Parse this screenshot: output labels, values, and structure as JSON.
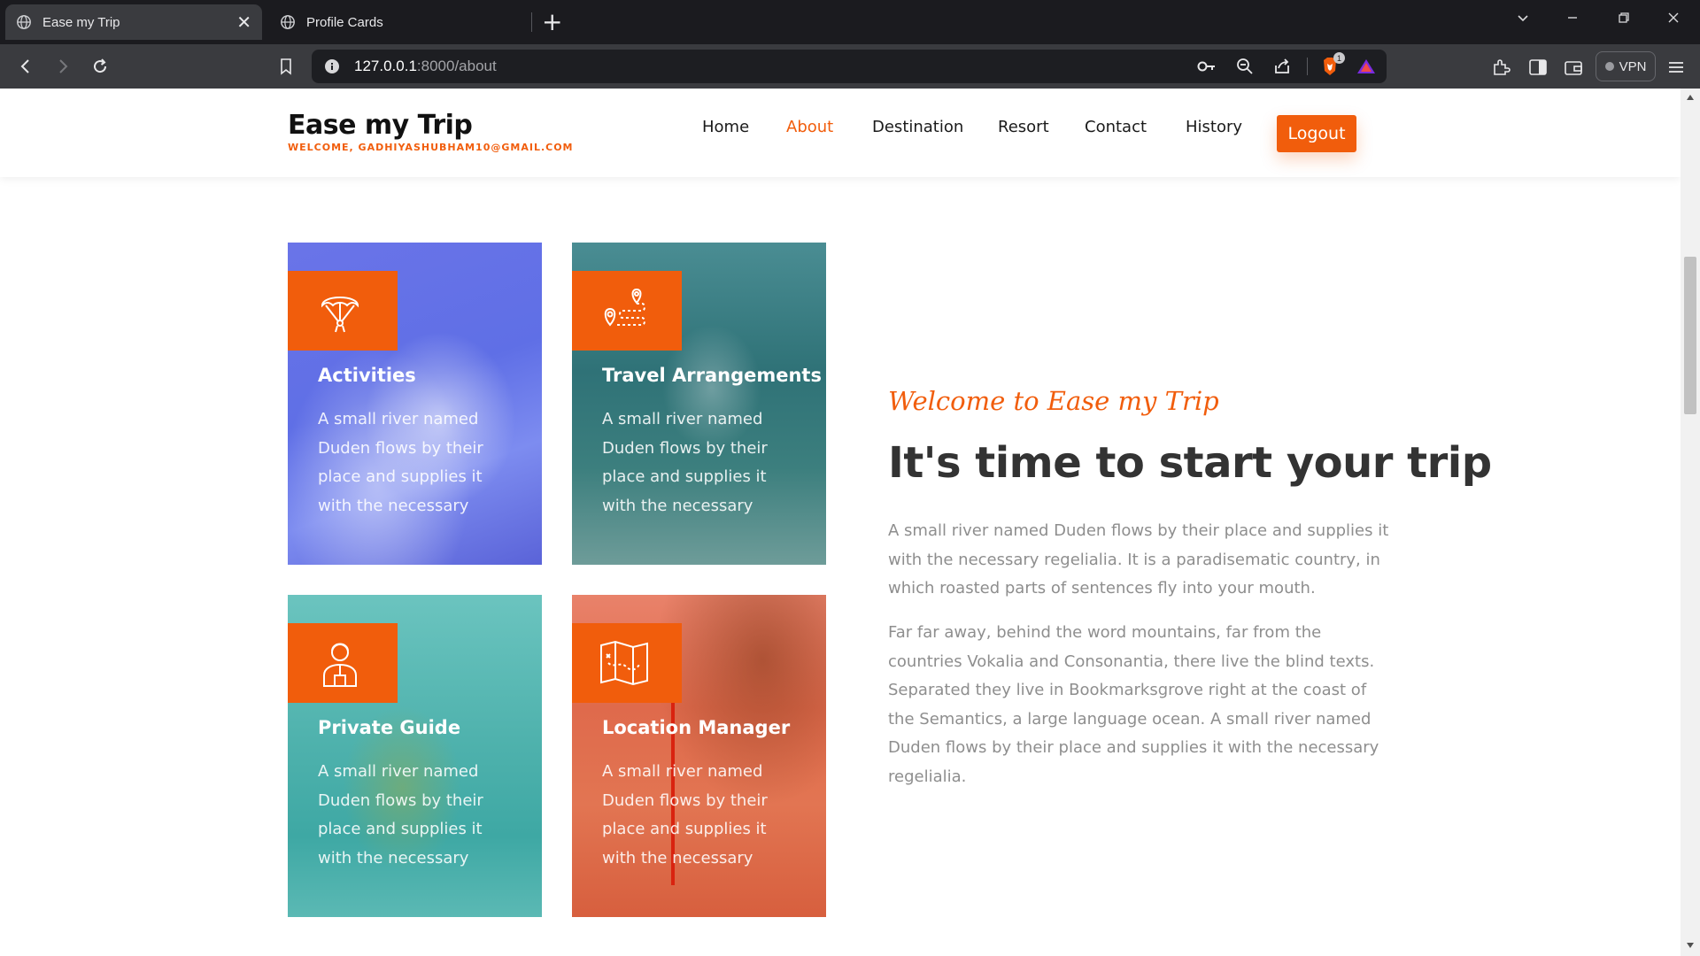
{
  "browser": {
    "tabs": [
      {
        "title": "Ease my Trip",
        "active": true
      },
      {
        "title": "Profile Cards",
        "active": false
      }
    ],
    "url_host": "127.0.0.1",
    "url_path": ":8000/about",
    "vpn_label": "VPN",
    "shield_badge": "1"
  },
  "header": {
    "brand": "Ease my Trip",
    "welcome": "WELCOME, GADHIYASHUBHAM10@GMAIL.COM",
    "nav": [
      "Home",
      "About",
      "Destination",
      "Resort",
      "Contact",
      "History"
    ],
    "active_nav": "About",
    "logout_label": "Logout"
  },
  "services": [
    {
      "title": "Activities",
      "text": "A small river named Duden flows by their place and supplies it with the necessary",
      "icon": "parachute-icon"
    },
    {
      "title": "Travel Arrangements",
      "text": "A small river named Duden flows by their place and supplies it with the necessary",
      "icon": "route-map-pin-icon"
    },
    {
      "title": "Private Guide",
      "text": "A small river named Duden flows by their place and supplies it with the necessary",
      "icon": "guide-person-icon"
    },
    {
      "title": "Location Manager",
      "text": "A small river named Duden flows by their place and supplies it with the necessary",
      "icon": "folded-map-icon"
    }
  ],
  "intro": {
    "subheading": "Welcome to Ease my Trip",
    "heading": "It's time to start your trip",
    "paragraph1": "A small river named Duden flows by their place and supplies it with the necessary regelialia. It is a paradisematic country, in which roasted parts of sentences fly into your mouth.",
    "paragraph2": "Far far away, behind the word mountains, far from the countries Vokalia and Consonantia, there live the blind texts. Separated they live in Bookmarksgrove right at the coast of the Semantics, a large language ocean. A small river named Duden flows by their place and supplies it with the necessary regelialia."
  },
  "colors": {
    "accent": "#f15d0c"
  }
}
